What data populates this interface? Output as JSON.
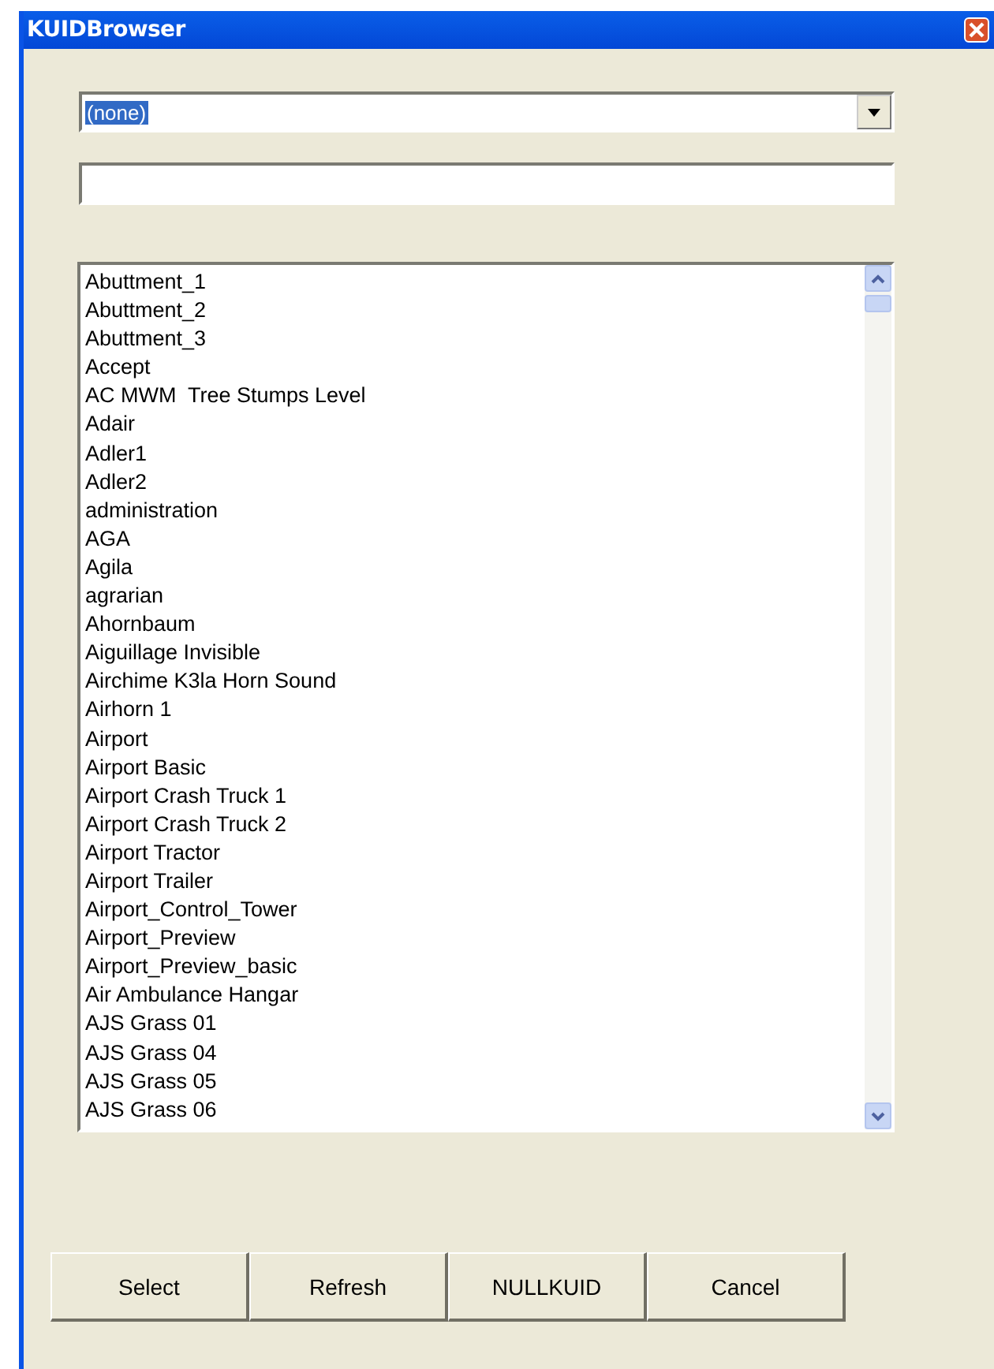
{
  "window": {
    "title": "KUIDBrowser"
  },
  "combo": {
    "value": "(none)",
    "value_selected": true
  },
  "list": {
    "items": [
      "Abuttment_1",
      "Abuttment_2",
      "Abuttment_3",
      "Accept",
      "AC MWM  Tree Stumps Level",
      "Adair",
      "Adler1",
      "Adler2",
      "administration",
      "AGA",
      "Agila",
      "agrarian",
      "Ahornbaum",
      "Aiguillage Invisible",
      "Airchime K3la Horn Sound",
      "Airhorn 1",
      "Airport",
      "Airport Basic",
      "Airport Crash Truck 1",
      "Airport Crash Truck 2",
      "Airport Tractor",
      "Airport Trailer",
      "Airport_Control_Tower",
      "Airport_Preview",
      "Airport_Preview_basic",
      "Air Ambulance Hangar",
      "AJS Grass 01",
      "AJS Grass 04",
      "AJS Grass 05",
      "AJS Grass 06"
    ]
  },
  "buttons": [
    "Select",
    "Refresh",
    "NULLKUID",
    "Cancel"
  ]
}
